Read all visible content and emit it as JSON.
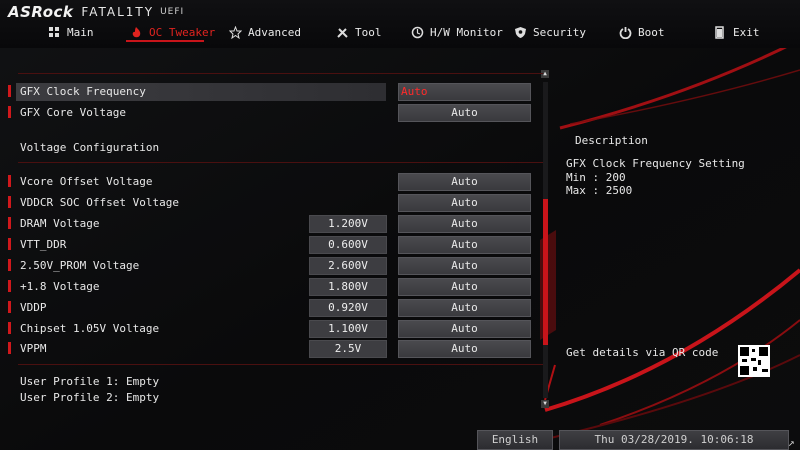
{
  "header": {
    "brand": "ASRock",
    "product": "FATAL1TY",
    "uefi": "UEFI"
  },
  "nav": [
    {
      "label": "Main",
      "icon": "grid-icon",
      "active": false
    },
    {
      "label": "OC Tweaker",
      "icon": "flame-icon",
      "active": true
    },
    {
      "label": "Advanced",
      "icon": "star-icon",
      "active": false
    },
    {
      "label": "Tool",
      "icon": "tools-icon",
      "active": false
    },
    {
      "label": "H/W Monitor",
      "icon": "monitor-icon",
      "active": false
    },
    {
      "label": "Security",
      "icon": "shield-icon",
      "active": false
    },
    {
      "label": "Boot",
      "icon": "power-icon",
      "active": false
    },
    {
      "label": "Exit",
      "icon": "exit-icon",
      "active": false
    }
  ],
  "settings": {
    "gfx_clock": {
      "label": "GFX Clock Frequency",
      "value": "Auto"
    },
    "gfx_core": {
      "label": "GFX Core Voltage",
      "value": "Auto"
    },
    "voltage_section": "Voltage Configuration",
    "voltages": [
      {
        "label": "Vcore Offset Voltage",
        "current": "",
        "value": "Auto"
      },
      {
        "label": "VDDCR SOC Offset Voltage",
        "current": "",
        "value": "Auto"
      },
      {
        "label": "DRAM Voltage",
        "current": "1.200V",
        "value": "Auto"
      },
      {
        "label": "VTT_DDR",
        "current": "0.600V",
        "value": "Auto"
      },
      {
        "label": "2.50V_PROM Voltage",
        "current": "2.600V",
        "value": "Auto"
      },
      {
        "label": "+1.8 Voltage",
        "current": "1.800V",
        "value": "Auto"
      },
      {
        "label": "VDDP",
        "current": "0.920V",
        "value": "Auto"
      },
      {
        "label": "Chipset 1.05V Voltage",
        "current": "1.100V",
        "value": "Auto"
      },
      {
        "label": "VPPM",
        "current": "2.5V",
        "value": "Auto"
      }
    ],
    "profiles": [
      "User Profile 1: Empty",
      "User Profile 2: Empty"
    ]
  },
  "description": {
    "title": "Description",
    "lines": [
      "GFX Clock Frequency Setting",
      "Min : 200",
      "Max : 2500"
    ],
    "qr_text": "Get details via QR code"
  },
  "footer": {
    "language": "English",
    "datetime": "Thu 03/28/2019. 10:06:18",
    "corner": "↗"
  },
  "colors": {
    "accent": "#d0181c",
    "background": "#0b0b0c"
  }
}
